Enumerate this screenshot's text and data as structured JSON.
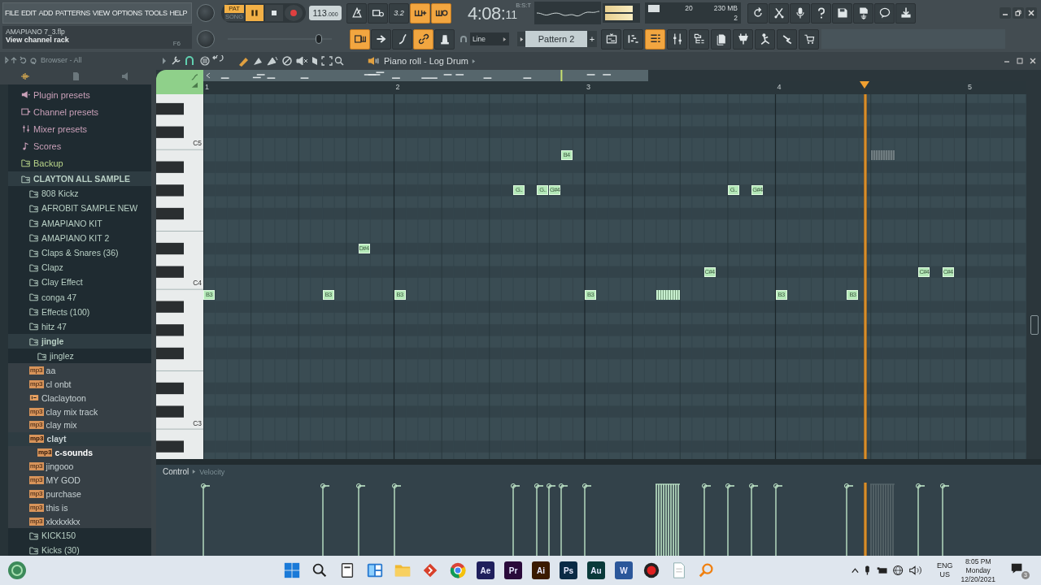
{
  "menu": [
    "FILE",
    "EDIT",
    "ADD",
    "PATTERNS",
    "VIEW",
    "OPTIONS",
    "TOOLS",
    "HELP"
  ],
  "project": {
    "file": "AMAPIANO 7_3.flp",
    "hint": "View channel rack",
    "shortcut": "F6"
  },
  "master_volume": {
    "level": 0.9
  },
  "transport": {
    "modes": [
      {
        "label": "PAT",
        "selected": true
      },
      {
        "label": "SONG",
        "selected": false
      }
    ],
    "playing": true
  },
  "tempo": {
    "value": "113",
    "decimals": ".000"
  },
  "record_buttons": [
    {
      "kind": "metronome",
      "on": false
    },
    {
      "kind": "wait",
      "on": false
    },
    {
      "kind": "countdown",
      "label": "3.2",
      "on": false
    },
    {
      "kind": "typing",
      "on": true
    },
    {
      "kind": "loop",
      "on": true
    }
  ],
  "clock": {
    "time": "4:08:",
    "small": "11",
    "format": "B:S:T"
  },
  "monitor": {
    "cpu": "20",
    "memory": "230 MB",
    "voices": "2"
  },
  "tool_buttons": [
    {
      "kind": "undo"
    },
    {
      "kind": "cut"
    },
    {
      "kind": "mic"
    },
    {
      "kind": "help"
    },
    {
      "kind": "save"
    },
    {
      "kind": "export"
    },
    {
      "kind": "chat"
    },
    {
      "kind": "download"
    }
  ],
  "edit_buttons": [
    {
      "kind": "stepedit",
      "on": true
    },
    {
      "kind": "arrow",
      "on": false
    },
    {
      "kind": "slide",
      "on": false
    },
    {
      "kind": "link",
      "on": true
    },
    {
      "kind": "bell",
      "on": false
    }
  ],
  "line_mode": "Line",
  "pattern": "Pattern 2",
  "pattern_add": "+",
  "view_buttons": [
    {
      "kind": "playlist",
      "on": false
    },
    {
      "kind": "pianoroll",
      "on": false
    },
    {
      "kind": "channelrack",
      "on": true
    },
    {
      "kind": "mixer",
      "on": false
    },
    {
      "kind": "browser",
      "on": false
    },
    {
      "kind": "project",
      "on": false
    },
    {
      "kind": "plugin",
      "on": false
    },
    {
      "kind": "keyboard",
      "on": false
    },
    {
      "kind": "touch",
      "on": false
    },
    {
      "kind": "shop",
      "on": false
    }
  ],
  "browser": {
    "title": "Browser - All",
    "items": [
      {
        "kind": "plugin",
        "label": "Plugin presets",
        "selected": false
      },
      {
        "kind": "channel",
        "label": "Channel presets",
        "selected": false
      },
      {
        "kind": "mixer",
        "label": "Mixer presets",
        "selected": false
      },
      {
        "kind": "scores",
        "label": "Scores",
        "selected": false
      },
      {
        "kind": "backup",
        "label": "Backup",
        "selected": false
      },
      {
        "kind": "folder",
        "label": "CLAYTON ALL SAMPLE",
        "selected": false,
        "expanded": true,
        "children": [
          {
            "kind": "folder",
            "label": "808 Kickz",
            "selected": false,
            "expanded": false
          },
          {
            "kind": "folder",
            "label": "AFROBIT SAMPLE NEW",
            "selected": false,
            "expanded": false
          },
          {
            "kind": "folder",
            "label": "AMAPIANO KIT",
            "selected": false,
            "expanded": false
          },
          {
            "kind": "folder",
            "label": "AMAPIANO KIT 2",
            "selected": false,
            "expanded": false
          },
          {
            "kind": "folder",
            "label": "Claps & Snares (36)",
            "selected": false,
            "expanded": false
          },
          {
            "kind": "folder",
            "label": "Clapz",
            "selected": false,
            "expanded": false
          },
          {
            "kind": "folder",
            "label": "Clay Effect",
            "selected": false,
            "expanded": false
          },
          {
            "kind": "folder",
            "label": "conga 47",
            "selected": false,
            "expanded": false
          },
          {
            "kind": "folder",
            "label": "Effects (100)",
            "selected": false,
            "expanded": false
          },
          {
            "kind": "folder",
            "label": "hitz 47",
            "selected": false,
            "expanded": false
          },
          {
            "kind": "folder",
            "label": "jingle",
            "selected": false,
            "expanded": true,
            "children": [
              {
                "kind": "folder",
                "label": "jinglez",
                "selected": false,
                "expanded": false
              }
            ]
          },
          {
            "kind": "audio",
            "badge": "mp3",
            "label": "aa",
            "selected": false
          },
          {
            "kind": "audio",
            "badge": "mp3",
            "label": "cl onbt",
            "selected": false
          },
          {
            "kind": "clip",
            "label": "Claclaytoon",
            "selected": false
          },
          {
            "kind": "audio",
            "badge": "mp3",
            "label": "clay mix track",
            "selected": false
          },
          {
            "kind": "audio",
            "badge": "mp3",
            "label": "clay mix",
            "selected": false
          },
          {
            "kind": "audio",
            "badge": "mp3",
            "label": "clayt",
            "selected": false,
            "expanded": true,
            "children": [
              {
                "kind": "audio",
                "badge": "mp3",
                "label": "c-sounds",
                "selected": true
              }
            ]
          },
          {
            "kind": "audio",
            "badge": "mp3",
            "label": "jingooo",
            "selected": false
          },
          {
            "kind": "audio",
            "badge": "mp3",
            "label": "MY GOD",
            "selected": false
          },
          {
            "kind": "audio",
            "badge": "mp3",
            "label": "purchase",
            "selected": false
          },
          {
            "kind": "audio",
            "badge": "mp3",
            "label": "this is",
            "selected": false
          },
          {
            "kind": "audio",
            "badge": "mp3",
            "label": "xkxkxkkx",
            "selected": false
          },
          {
            "kind": "folder",
            "label": "KICK150",
            "selected": false,
            "expanded": false
          },
          {
            "kind": "folder",
            "label": "Kicks (30)",
            "selected": false,
            "expanded": false
          }
        ]
      }
    ]
  },
  "piano_roll": {
    "title": "Piano roll - Log Drum",
    "ruler": [
      "1",
      "2",
      "3",
      "4",
      "5"
    ],
    "keys": [
      "C5",
      "C4",
      "C3"
    ],
    "notes": [
      {
        "kind": "note",
        "label": "B3",
        "ghost": false
      },
      {
        "kind": "note",
        "label": "B3",
        "ghost": false
      },
      {
        "kind": "note",
        "label": "D#4",
        "ghost": false
      },
      {
        "kind": "note",
        "label": "B3",
        "ghost": false
      },
      {
        "kind": "note",
        "label": "G..",
        "ghost": false
      },
      {
        "kind": "note",
        "label": "G..",
        "ghost": false
      },
      {
        "kind": "note",
        "label": "G#4",
        "ghost": false
      },
      {
        "kind": "note",
        "label": "B4",
        "ghost": false
      },
      {
        "kind": "note",
        "label": "B3",
        "ghost": false
      },
      {
        "kind": "burst",
        "ghost": false
      },
      {
        "kind": "note",
        "label": "C#4",
        "ghost": false
      },
      {
        "kind": "note",
        "label": "G..",
        "ghost": false
      },
      {
        "kind": "note",
        "label": "G#4",
        "ghost": false
      },
      {
        "kind": "note",
        "label": "B3",
        "ghost": false
      },
      {
        "kind": "note",
        "label": "B3",
        "ghost": false
      },
      {
        "kind": "burst",
        "ghost": true
      },
      {
        "kind": "note",
        "label": "C#4",
        "ghost": false
      },
      {
        "kind": "note",
        "label": "C#4",
        "ghost": false
      }
    ],
    "control": {
      "label": "Control",
      "parameter": "Velocity"
    }
  },
  "taskbar": {
    "apps": [
      {
        "kind": "start"
      },
      {
        "kind": "search"
      },
      {
        "kind": "files"
      },
      {
        "kind": "widgets"
      },
      {
        "kind": "folder"
      },
      {
        "kind": "diamond"
      },
      {
        "kind": "globe"
      },
      {
        "kind": "tile",
        "label": "Ae",
        "color": "#1f1f5c"
      },
      {
        "kind": "tile",
        "label": "Pr",
        "color": "#2a0a3a"
      },
      {
        "kind": "tile",
        "label": "Ai",
        "color": "#3a1a00"
      },
      {
        "kind": "tile",
        "label": "Ps",
        "color": "#0a2a45"
      },
      {
        "kind": "tile",
        "label": "Au",
        "color": "#0a3a3a"
      },
      {
        "kind": "tile",
        "label": "W",
        "color": "#2b579a"
      },
      {
        "kind": "record"
      },
      {
        "kind": "document"
      },
      {
        "kind": "magnifier"
      }
    ],
    "language": [
      "ENG",
      "US"
    ],
    "clock": [
      "8:05 PM",
      "Monday",
      "12/20/2021"
    ],
    "notifications": "3"
  }
}
